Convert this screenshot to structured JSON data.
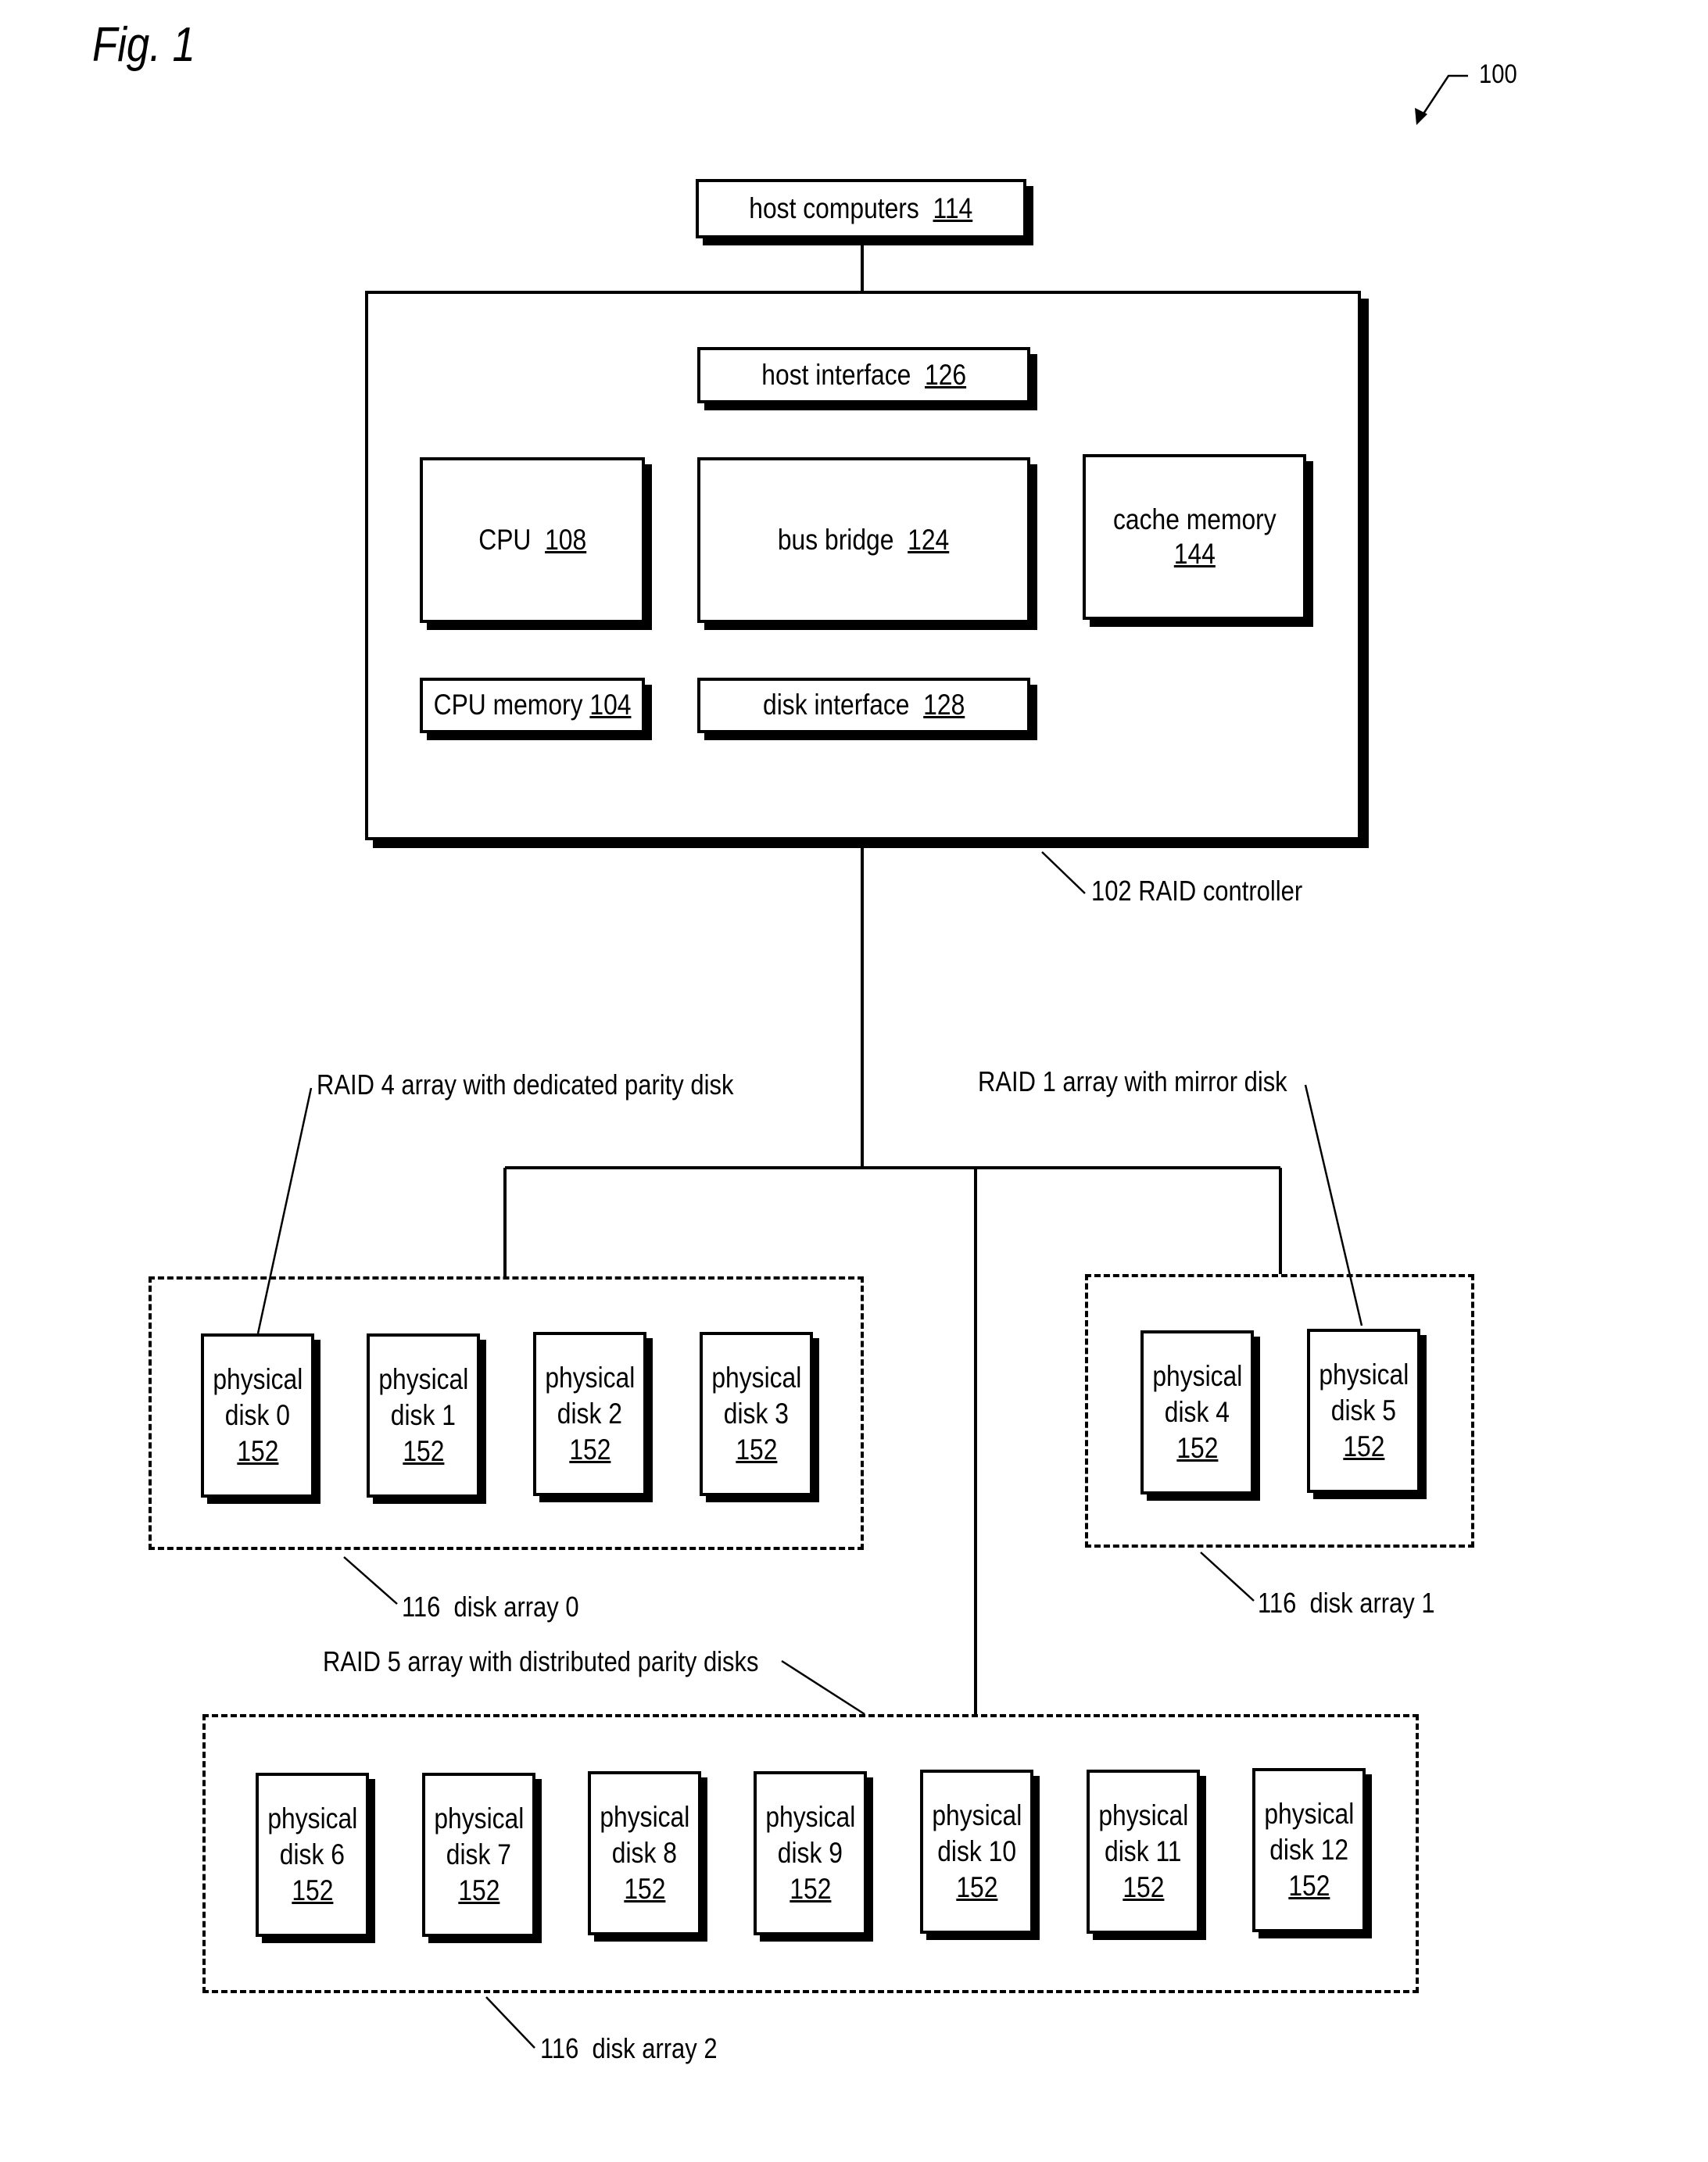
{
  "figure": {
    "title": "Fig. 1",
    "reference_number": "100"
  },
  "controller": {
    "host_computers": {
      "label": "host computers",
      "ref": "114"
    },
    "raid_controller_label": "102 RAID controller",
    "host_interface": {
      "label": "host interface",
      "ref": "126"
    },
    "cpu": {
      "label": "CPU",
      "ref": "108"
    },
    "bus_bridge": {
      "label": "bus bridge",
      "ref": "124"
    },
    "cache_memory": {
      "label": "cache memory",
      "ref": "144"
    },
    "cpu_memory": {
      "label": "CPU memory",
      "ref": "104"
    },
    "disk_interface": {
      "label": "disk interface",
      "ref": "128"
    }
  },
  "arrays": {
    "raid4_label": "RAID 4 array with dedicated parity disk",
    "raid1_label": "RAID 1 array with mirror disk",
    "raid5_label": "RAID 5 array with distributed parity disks",
    "array0_label": "116  disk array 0",
    "array1_label": "116  disk array 1",
    "array2_label": "116  disk array 2",
    "disk_word": "physical",
    "disk_ref": "152",
    "disks": [
      {
        "name": "disk 0"
      },
      {
        "name": "disk 1"
      },
      {
        "name": "disk 2"
      },
      {
        "name": "disk 3"
      },
      {
        "name": "disk 4"
      },
      {
        "name": "disk 5"
      },
      {
        "name": "disk 6"
      },
      {
        "name": "disk 7"
      },
      {
        "name": "disk 8"
      },
      {
        "name": "disk 9"
      },
      {
        "name": "disk 10"
      },
      {
        "name": "disk 11"
      },
      {
        "name": "disk 12"
      }
    ]
  }
}
